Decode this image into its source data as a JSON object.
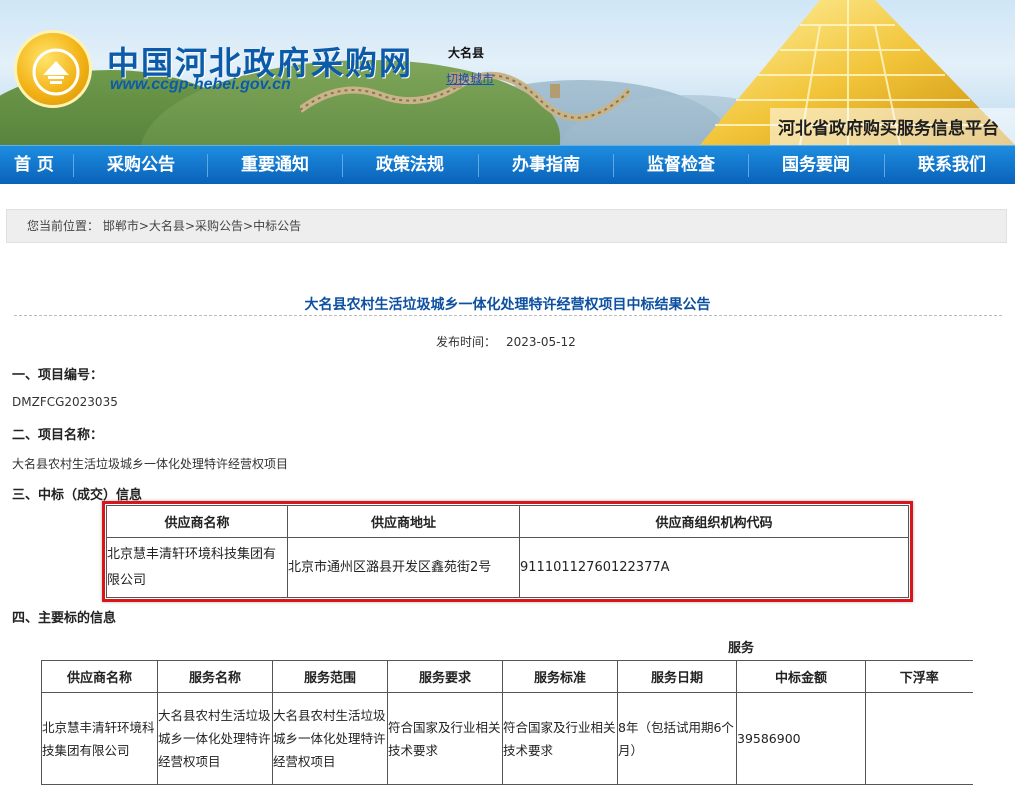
{
  "header": {
    "site_title": "中国河北政府采购网",
    "site_url": "www.ccgp-hebei.gov.cn",
    "county": "大名县",
    "switch_city": "切换城市",
    "platform_name": "河北省政府购买服务信息平台"
  },
  "nav": {
    "items": [
      "首 页",
      "采购公告",
      "重要通知",
      "政策法规",
      "办事指南",
      "监督检查",
      "国务要闻",
      "联系我们"
    ]
  },
  "breadcrumb": {
    "prefix": "您当前位置：",
    "items": [
      "邯郸市",
      "大名县",
      "采购公告",
      "中标公告"
    ],
    "separator": ">"
  },
  "article": {
    "title": "大名县农村生活垃圾城乡一体化处理特许经营权项目中标结果公告",
    "pub_label": "发布时间：",
    "pub_date": "2023-05-12",
    "sec1_heading": "一、项目编号：",
    "project_no": "DMZFCG2023035",
    "sec2_heading": "二、项目名称：",
    "project_name": "大名县农村生活垃圾城乡一体化处理特许经营权项目",
    "sec3_heading": "三、中标（成交）信息",
    "sec4_heading": "四、主要标的信息",
    "service_label": "服务"
  },
  "winner_table": {
    "headers": [
      "供应商名称",
      "供应商地址",
      "供应商组织机构代码"
    ],
    "row": [
      "北京慧丰清轩环境科技集团有限公司",
      "北京市通州区潞县开发区鑫苑街2号",
      "91110112760122377A"
    ]
  },
  "subject_table": {
    "headers": [
      "供应商名称",
      "服务名称",
      "服务范围",
      "服务要求",
      "服务标准",
      "服务日期",
      "中标金额",
      "下浮率"
    ],
    "row": [
      "北京慧丰清轩环境科技集团有限公司",
      "大名县农村生活垃圾城乡一体化处理特许经营权项目",
      "大名县农村生活垃圾城乡一体化处理特许经营权项目",
      "符合国家及行业相关技术要求",
      "符合国家及行业相关技术要求",
      "8年（包括试用期6个月）",
      "39586900",
      ""
    ]
  }
}
